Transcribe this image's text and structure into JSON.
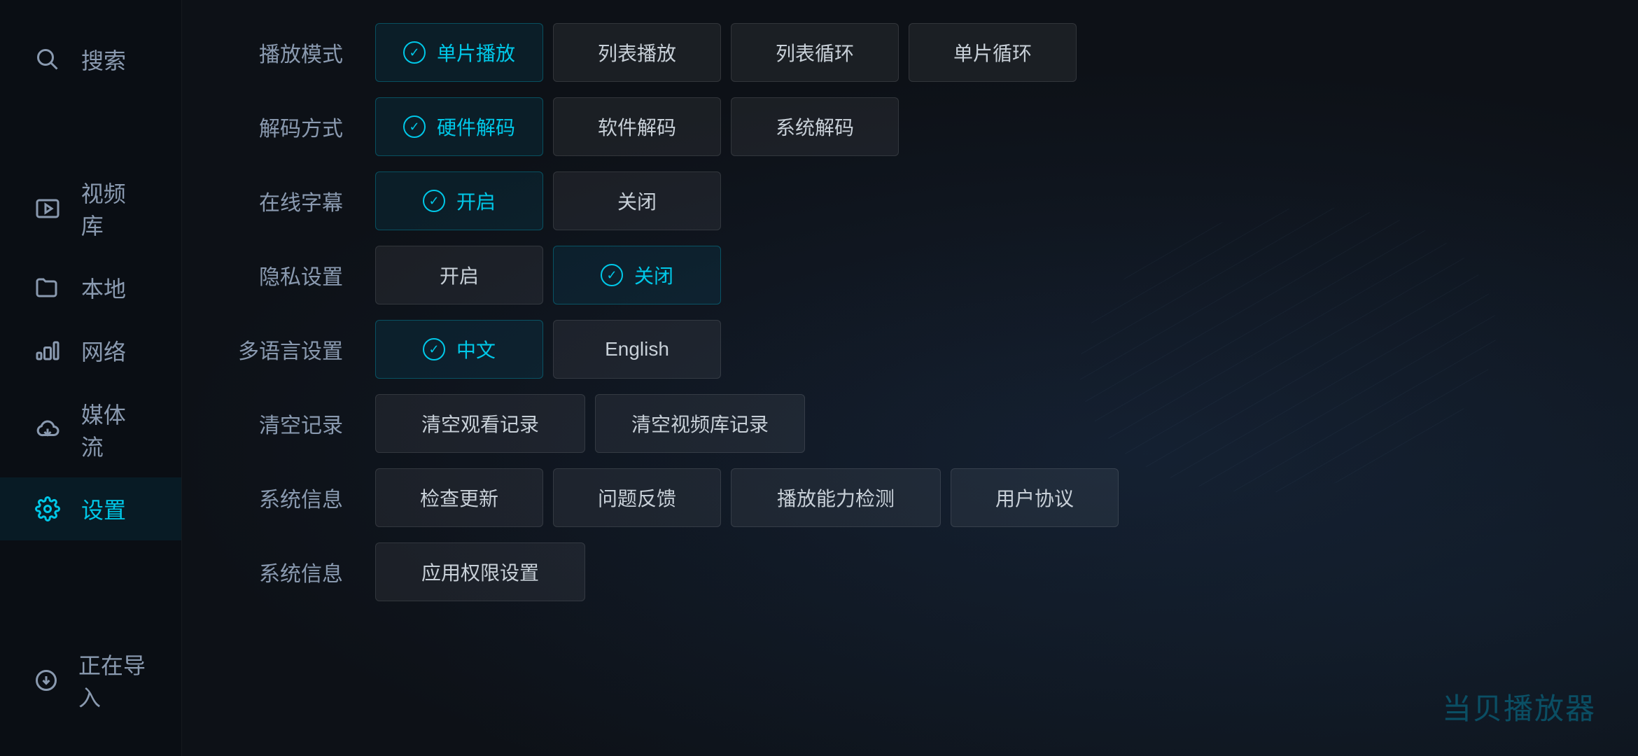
{
  "brand": "当贝播放器",
  "sidebar": {
    "items": [
      {
        "id": "search",
        "label": "搜索",
        "icon": "search"
      },
      {
        "id": "video-library",
        "label": "视频库",
        "icon": "video-library"
      },
      {
        "id": "local",
        "label": "本地",
        "icon": "folder"
      },
      {
        "id": "network",
        "label": "网络",
        "icon": "network"
      },
      {
        "id": "media-stream",
        "label": "媒体流",
        "icon": "cloud"
      },
      {
        "id": "settings",
        "label": "设置",
        "icon": "settings",
        "active": true
      }
    ],
    "bottom": {
      "id": "importing",
      "label": "正在导入",
      "icon": "download"
    }
  },
  "settings": {
    "rows": [
      {
        "id": "play-mode",
        "label": "播放模式",
        "options": [
          {
            "id": "single",
            "label": "单片播放",
            "selected": true
          },
          {
            "id": "list-play",
            "label": "列表播放",
            "selected": false
          },
          {
            "id": "list-loop",
            "label": "列表循环",
            "selected": false
          },
          {
            "id": "single-loop",
            "label": "单片循环",
            "selected": false
          }
        ]
      },
      {
        "id": "decode-mode",
        "label": "解码方式",
        "options": [
          {
            "id": "hardware",
            "label": "硬件解码",
            "selected": true
          },
          {
            "id": "software",
            "label": "软件解码",
            "selected": false
          },
          {
            "id": "system",
            "label": "系统解码",
            "selected": false
          }
        ]
      },
      {
        "id": "online-subtitle",
        "label": "在线字幕",
        "options": [
          {
            "id": "on",
            "label": "开启",
            "selected": true
          },
          {
            "id": "off",
            "label": "关闭",
            "selected": false
          }
        ]
      },
      {
        "id": "privacy",
        "label": "隐私设置",
        "options": [
          {
            "id": "on",
            "label": "开启",
            "selected": false
          },
          {
            "id": "off",
            "label": "关闭",
            "selected": true
          }
        ]
      },
      {
        "id": "language",
        "label": "多语言设置",
        "options": [
          {
            "id": "chinese",
            "label": "中文",
            "selected": true
          },
          {
            "id": "english",
            "label": "English",
            "selected": false
          }
        ]
      },
      {
        "id": "clear-records",
        "label": "清空记录",
        "options": [
          {
            "id": "clear-watch",
            "label": "清空观看记录",
            "selected": false
          },
          {
            "id": "clear-library",
            "label": "清空视频库记录",
            "selected": false
          }
        ]
      },
      {
        "id": "system-info",
        "label": "系统信息",
        "options": [
          {
            "id": "check-update",
            "label": "检查更新",
            "selected": false
          },
          {
            "id": "feedback",
            "label": "问题反馈",
            "selected": false
          },
          {
            "id": "play-detect",
            "label": "播放能力检测",
            "selected": false
          },
          {
            "id": "user-agreement",
            "label": "用户协议",
            "selected": false
          }
        ]
      },
      {
        "id": "system-info-2",
        "label": "系统信息",
        "options": [
          {
            "id": "app-permissions",
            "label": "应用权限设置",
            "selected": false
          }
        ]
      }
    ]
  }
}
